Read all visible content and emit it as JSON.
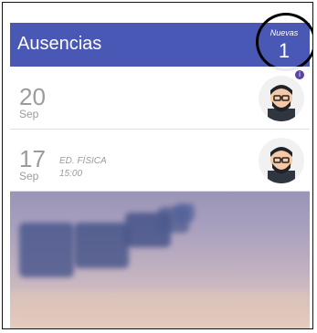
{
  "header": {
    "title": "Ausencias",
    "new_label": "Nuevas",
    "new_count": "1"
  },
  "items": [
    {
      "day": "20",
      "month": "Sep",
      "subject": "",
      "time": ""
    },
    {
      "day": "17",
      "month": "Sep",
      "subject": "ED. FÍSICA",
      "time": "15:00"
    }
  ],
  "colors": {
    "header": "#4a58b5",
    "text_gray": "#9b9b9b"
  },
  "icons": {
    "avatar": "person-avatar-icon",
    "info": "info-icon"
  }
}
